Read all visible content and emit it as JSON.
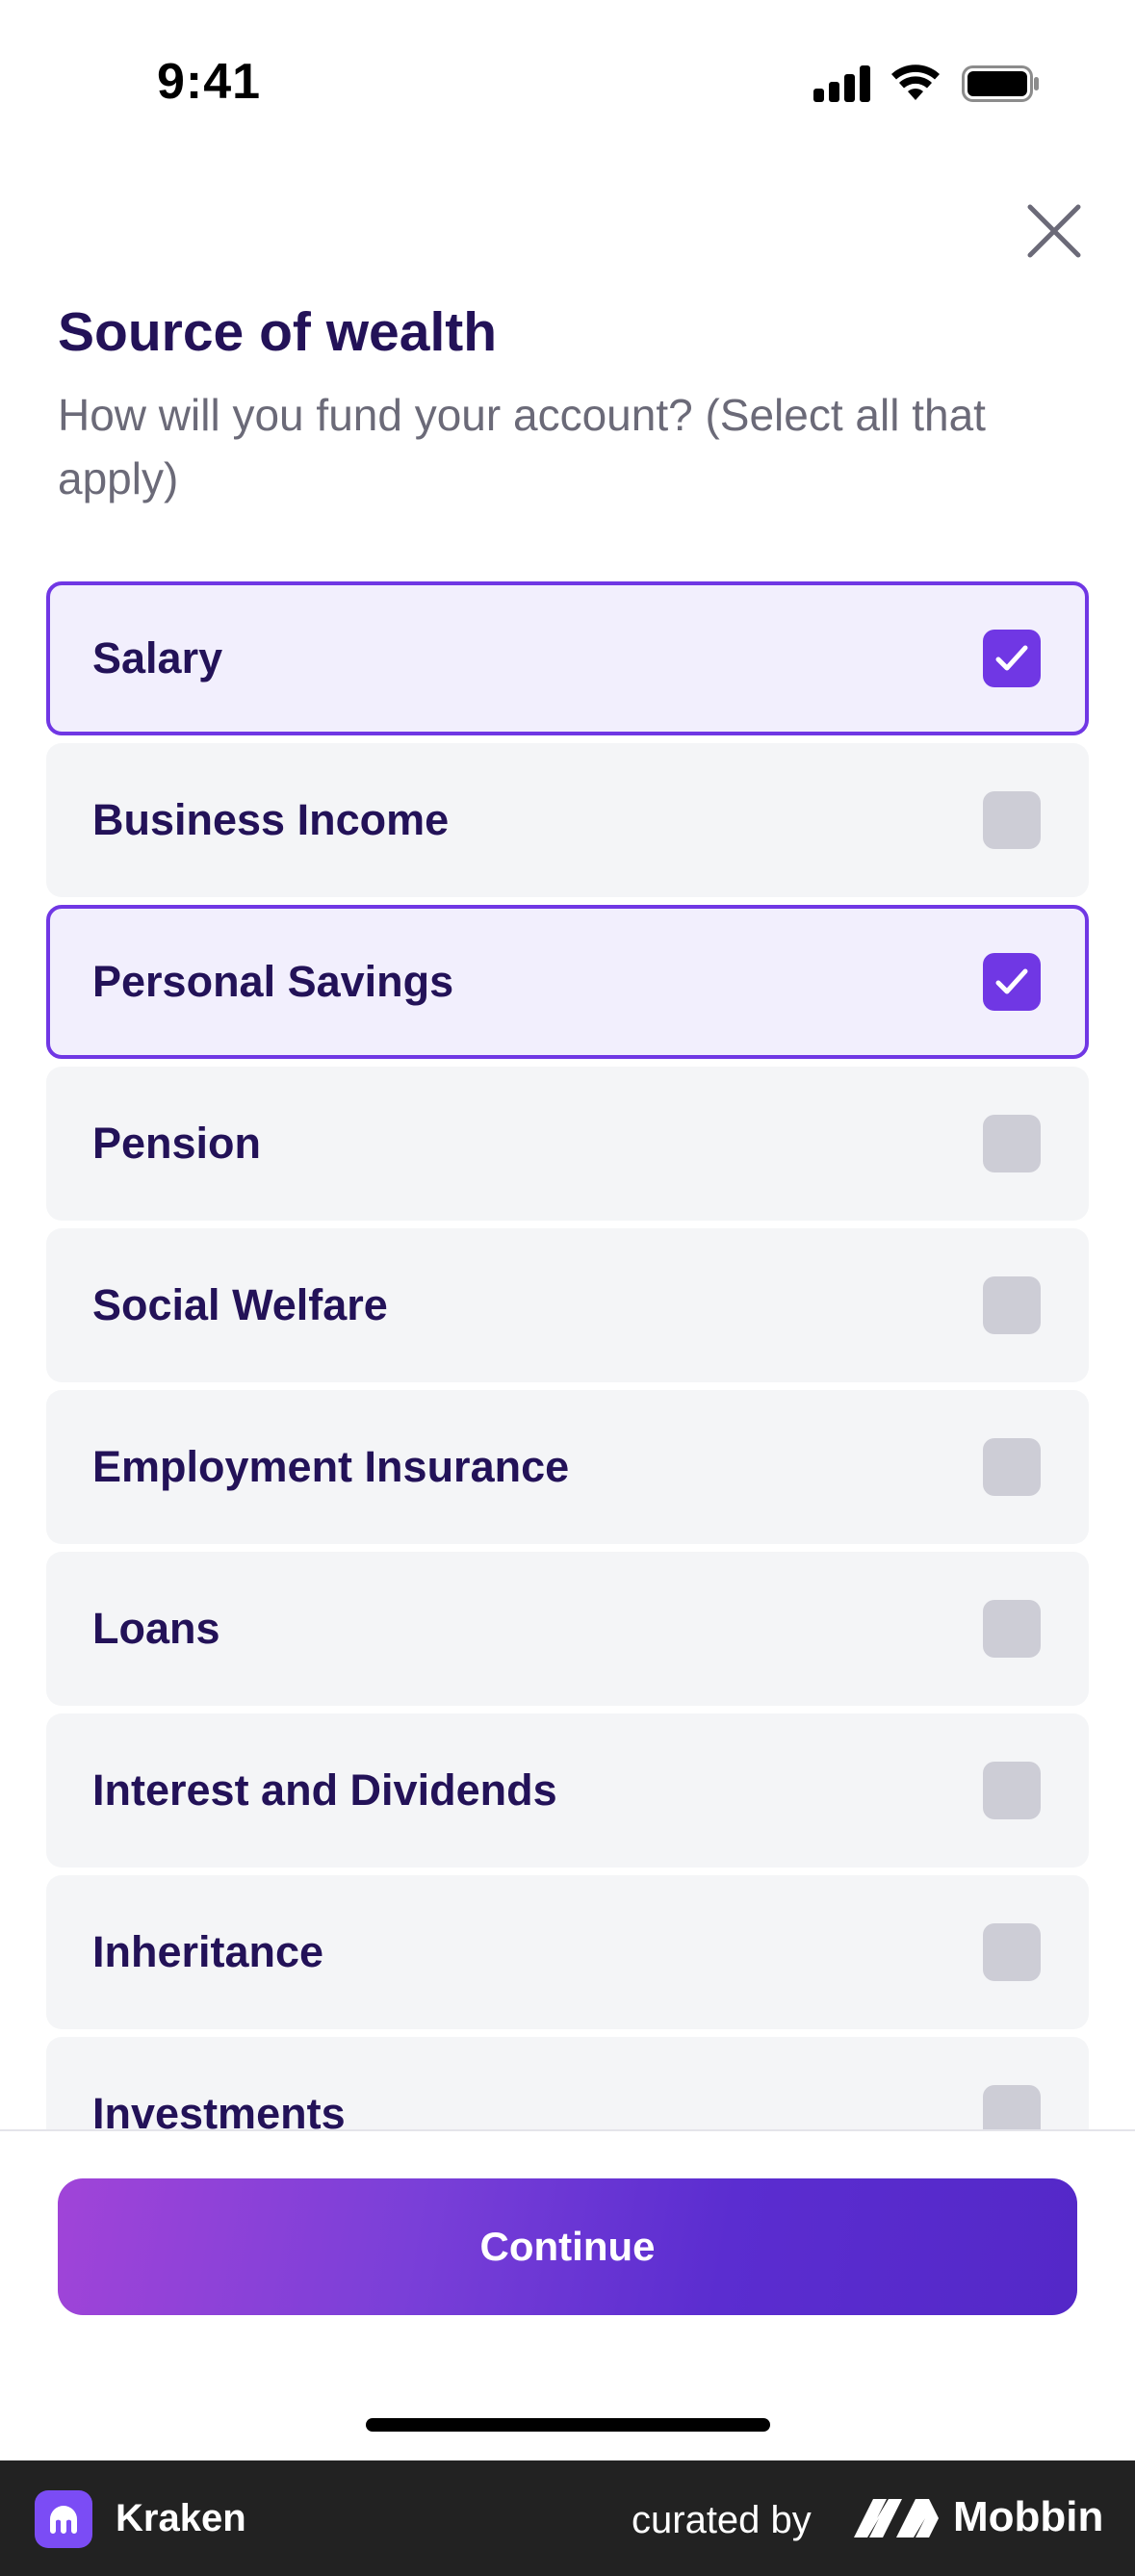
{
  "status_bar": {
    "time": "9:41"
  },
  "header": {
    "title": "Source of wealth",
    "subtitle": "How will you fund your account? (Select all that apply)"
  },
  "options": [
    {
      "label": "Salary",
      "selected": true
    },
    {
      "label": "Business Income",
      "selected": false
    },
    {
      "label": "Personal Savings",
      "selected": true
    },
    {
      "label": "Pension",
      "selected": false
    },
    {
      "label": "Social Welfare",
      "selected": false
    },
    {
      "label": "Employment Insurance",
      "selected": false
    },
    {
      "label": "Loans",
      "selected": false
    },
    {
      "label": "Interest and Dividends",
      "selected": false
    },
    {
      "label": "Inheritance",
      "selected": false
    },
    {
      "label": "Investments",
      "selected": false
    }
  ],
  "footer": {
    "continue_label": "Continue"
  },
  "brand_bar": {
    "app_name": "Kraken",
    "curated_by": "curated by",
    "mobbin": "Mobbin"
  },
  "colors": {
    "accent": "#7037e4",
    "text": "#231258",
    "muted": "#6b6a78",
    "option_bg": "#f4f5f7",
    "selected_bg": "#f2effd"
  }
}
